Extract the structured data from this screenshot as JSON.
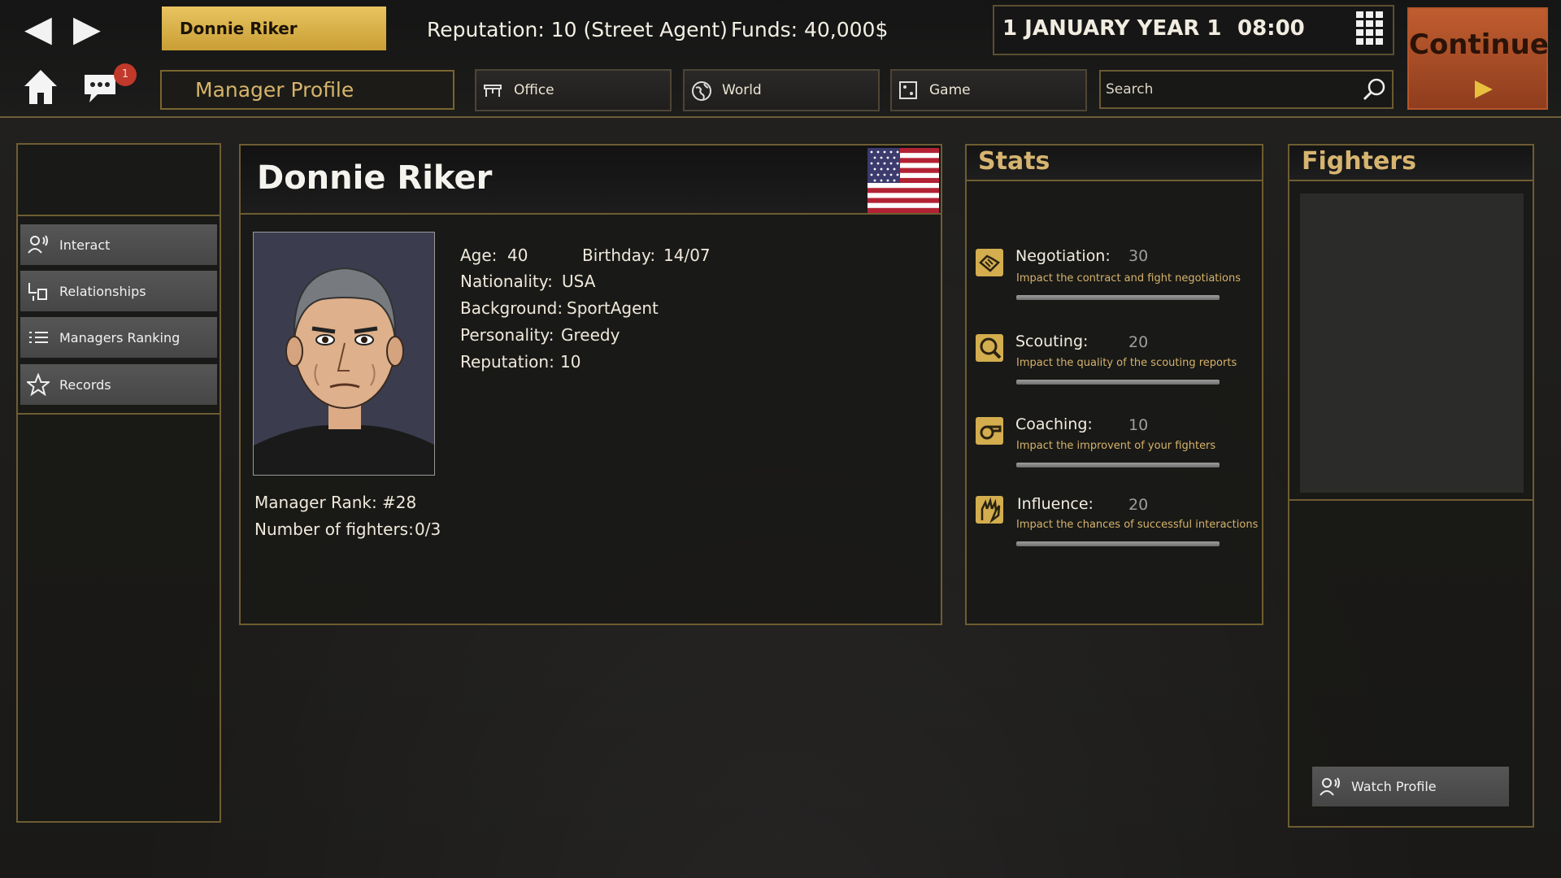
{
  "topbar": {
    "manager_name": "Donnie Riker",
    "reputation": "Reputation: 10 (Street Agent)",
    "funds": "Funds: 40,000$",
    "date": "1 JANUARY YEAR 1",
    "time": "08:00",
    "continue_label": "Continue",
    "notification_count": "1"
  },
  "nav": {
    "page_tab": "Manager Profile",
    "tabs": [
      {
        "label": "Office",
        "icon": "office-icon"
      },
      {
        "label": "World",
        "icon": "globe-icon"
      },
      {
        "label": "Game",
        "icon": "game-icon"
      }
    ],
    "search_placeholder": "Search"
  },
  "sidebar": {
    "items": [
      {
        "label": "Interact",
        "icon": "interact-icon"
      },
      {
        "label": "Relationships",
        "icon": "relationships-icon"
      },
      {
        "label": "Managers Ranking",
        "icon": "ranking-list-icon"
      },
      {
        "label": "Records",
        "icon": "star-icon"
      }
    ]
  },
  "profile": {
    "name": "Donnie Riker",
    "age_label": "Age:",
    "age": "40",
    "birthday_label": "Birthday:",
    "birthday": "14/07",
    "nationality_label": "Nationality:",
    "nationality": "USA",
    "background_label": "Background:",
    "background": "SportAgent",
    "personality_label": "Personality:",
    "personality": "Greedy",
    "reputation_label": "Reputation:",
    "reputation": "10",
    "rank_label": "Manager Rank:",
    "rank": "#28",
    "fighters_label": "Number of fighters:",
    "fighters": "0/3"
  },
  "stats": {
    "heading": "Stats",
    "items": [
      {
        "name": "Negotiation:",
        "value": "30",
        "desc": "Impact the contract and fight negotiations",
        "icon": "handshake-icon"
      },
      {
        "name": "Scouting:",
        "value": "20",
        "desc": "Impact the quality of the scouting reports",
        "icon": "magnifier-icon"
      },
      {
        "name": "Coaching:",
        "value": "10",
        "desc": "Impact the improvent of your fighters",
        "icon": "whistle-icon"
      },
      {
        "name": "Influence:",
        "value": "20",
        "desc": "Impact the chances of successful interactions",
        "icon": "influence-hand-icon"
      }
    ]
  },
  "fighters": {
    "heading": "Fighters",
    "watch_profile": "Watch Profile"
  },
  "colors": {
    "accent": "#d6b470",
    "continue": "#b05227",
    "gold_button": "#dfb84f"
  }
}
